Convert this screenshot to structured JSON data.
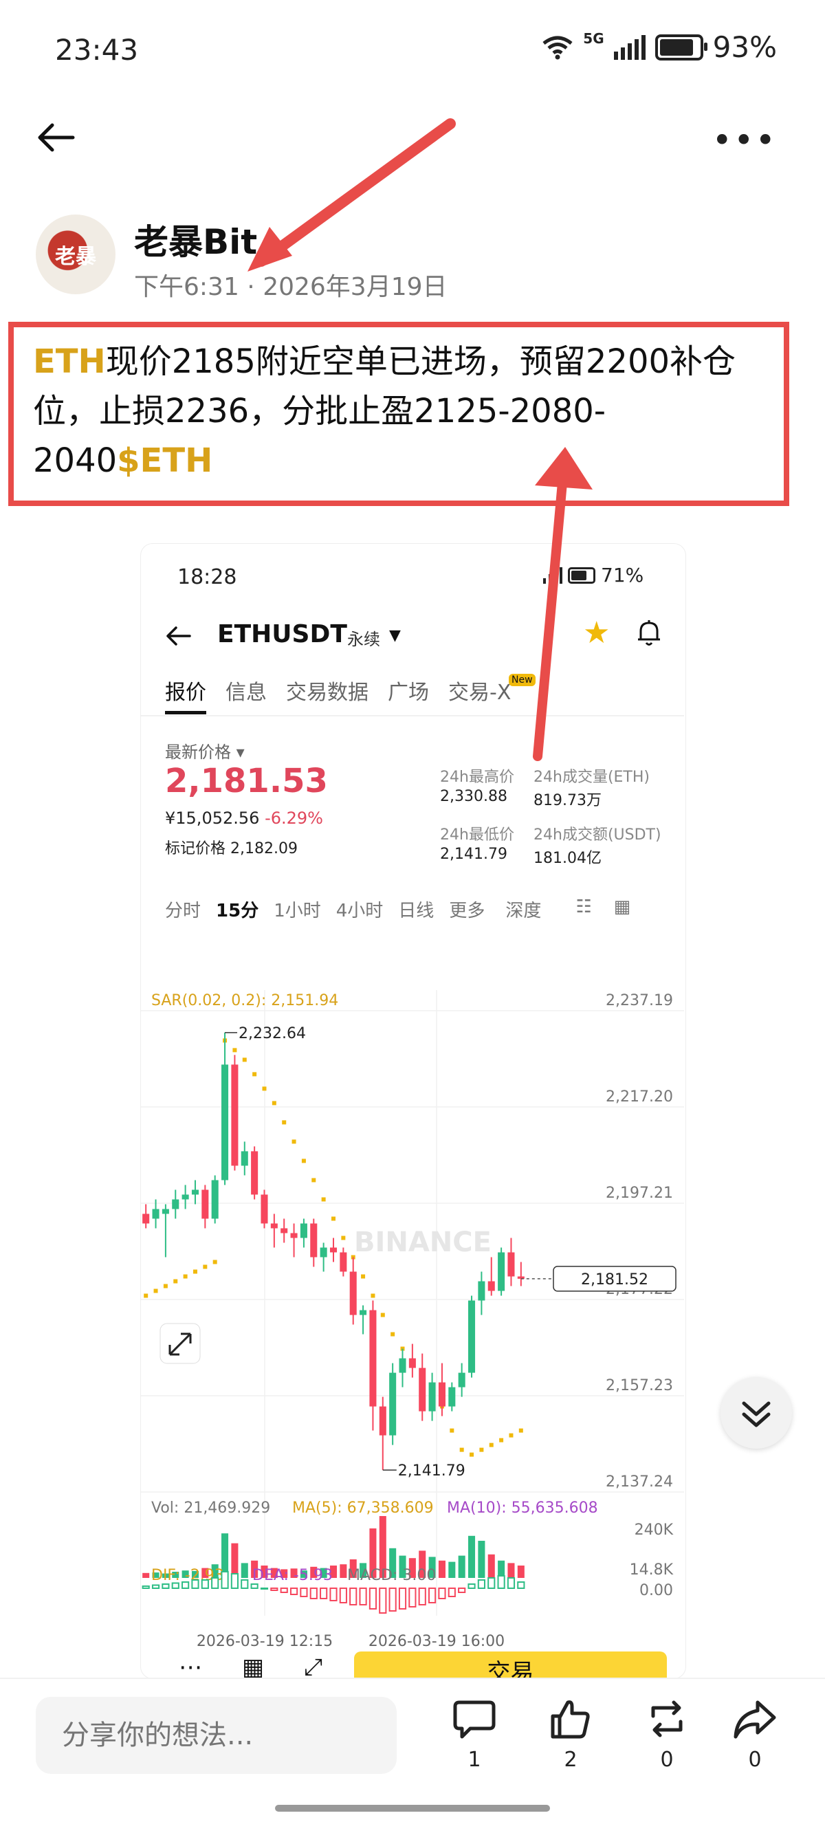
{
  "status_bar": {
    "time": "23:43",
    "network": "5G",
    "battery": "93%",
    "battery_level": 0.93
  },
  "header": {
    "back_icon": "arrow-left-icon",
    "more_label": "•••"
  },
  "author": {
    "name": "老暴Bit",
    "avatar_text": "老暴",
    "time": "下午6:31",
    "date": "2026年3月19日"
  },
  "post": {
    "ticker_1": "ETH",
    "text_1": "现价2185附近空单已进场，预留2200补仓位，止损2236，分批止盈2125-2080-2040",
    "ticker_2": "$ETH"
  },
  "screenshot": {
    "time": "18:28",
    "battery": "71%",
    "symbol": "ETHUSDT",
    "contract_type": "永续",
    "tabs": [
      "报价",
      "信息",
      "交易数据",
      "广场",
      "交易-X"
    ],
    "new_badge": "New",
    "last_price_label": "最新价格",
    "last_price": "2,181.53",
    "cny_price": "¥15,052.56",
    "change": "-6.29%",
    "mark_price_label": "标记价格",
    "mark_price": "2,182.09",
    "stats": {
      "high_label": "24h最高价",
      "high": "2,330.88",
      "low_label": "24h最低价",
      "low": "2,141.79",
      "vol_eth_label": "24h成交量(ETH)",
      "vol_eth": "819.73万",
      "vol_usdt_label": "24h成交额(USDT)",
      "vol_usdt": "181.04亿"
    },
    "intervals": [
      "分时",
      "15分",
      "1小时",
      "4小时",
      "日线",
      "更多",
      "深度"
    ],
    "active_interval": "15分",
    "sar_label": "SAR(0.02, 0.2): 2,151.94",
    "watermark": "BINANCE",
    "price_axis": [
      "2,237.19",
      "2,217.20",
      "2,197.21",
      "2,177.22",
      "2,157.23",
      "2,137.24"
    ],
    "current_price_tag": "2,181.52",
    "high_marker": "2,232.64",
    "low_marker": "2,141.79",
    "vol_label": "Vol: 21,469.929",
    "ma5_label": "MA(5): 67,358.609",
    "ma10_label": "MA(10): 55,635.608",
    "vol_axis": [
      "240K",
      "14.8K"
    ],
    "macd_dif": "DIF: -2.93",
    "macd_dea": "DEA: -5.93",
    "macd_val": "MACD: 3.00",
    "macd_axis": "0.00",
    "date_1": "2026-03-19 12:15",
    "date_2": "2026-03-19 16:00",
    "trade_button": "交易",
    "colors": {
      "up": "#2ebd85",
      "down": "#f6465d",
      "accent": "#f0b90b",
      "price": "#e0465b"
    }
  },
  "chart_data": {
    "type": "candlestick",
    "interval": "15m",
    "ylim": [
      2137.24,
      2237.19
    ],
    "candles_ohlc": [
      [
        2195,
        2197,
        2192,
        2193
      ],
      [
        2194,
        2198,
        2192,
        2196
      ],
      [
        2195,
        2197,
        2186,
        2196
      ],
      [
        2196,
        2200,
        2194,
        2198
      ],
      [
        2198,
        2201,
        2196,
        2199
      ],
      [
        2199,
        2202,
        2197,
        2200
      ],
      [
        2200,
        2201,
        2192,
        2194
      ],
      [
        2194,
        2203,
        2193,
        2202
      ],
      [
        2202,
        2232.64,
        2201,
        2226
      ],
      [
        2226,
        2228,
        2204,
        2205
      ],
      [
        2205,
        2210,
        2203,
        2208
      ],
      [
        2208,
        2209,
        2198,
        2199
      ],
      [
        2199,
        2200,
        2192,
        2193
      ],
      [
        2193,
        2195,
        2188,
        2192
      ],
      [
        2192,
        2194,
        2189,
        2191
      ],
      [
        2191,
        2193,
        2186,
        2190
      ],
      [
        2190,
        2194,
        2188,
        2193
      ],
      [
        2193,
        2194,
        2184,
        2186
      ],
      [
        2186,
        2189,
        2183,
        2188
      ],
      [
        2188,
        2190,
        2185,
        2187
      ],
      [
        2187,
        2188,
        2182,
        2183
      ],
      [
        2183,
        2186,
        2172,
        2174
      ],
      [
        2174,
        2176,
        2170,
        2175
      ],
      [
        2175,
        2177,
        2150,
        2155
      ],
      [
        2155,
        2157,
        2141.79,
        2149
      ],
      [
        2149,
        2164,
        2147,
        2162
      ],
      [
        2162,
        2167,
        2159,
        2165
      ],
      [
        2165,
        2168,
        2161,
        2163
      ],
      [
        2163,
        2166,
        2152,
        2154
      ],
      [
        2154,
        2162,
        2152,
        2160
      ],
      [
        2160,
        2164,
        2153,
        2155
      ],
      [
        2155,
        2160,
        2154,
        2159
      ],
      [
        2159,
        2164,
        2157,
        2162
      ],
      [
        2162,
        2178,
        2161,
        2177
      ],
      [
        2177,
        2183,
        2174,
        2181
      ],
      [
        2181,
        2186,
        2178,
        2179
      ],
      [
        2179,
        2188,
        2178,
        2187
      ],
      [
        2187,
        2190,
        2180,
        2182
      ],
      [
        2182,
        2185,
        2180,
        2181.52
      ]
    ],
    "sar_dots": [
      2178,
      2179,
      2180,
      2181,
      2182,
      2183,
      2184,
      2185,
      2231,
      2229,
      2227,
      2224,
      2221,
      2218,
      2214,
      2210,
      2206,
      2202,
      2198,
      2194,
      2190,
      2186,
      2182,
      2178,
      2174,
      2170,
      2167,
      2164,
      2161,
      2158,
      2155,
      2150,
      2146,
      2145,
      2146,
      2147,
      2148,
      2149,
      2150
    ],
    "volume_k": [
      20,
      22,
      18,
      25,
      30,
      28,
      40,
      55,
      180,
      140,
      60,
      70,
      50,
      40,
      35,
      38,
      30,
      45,
      40,
      50,
      55,
      75,
      60,
      200,
      250,
      120,
      90,
      80,
      110,
      85,
      70,
      65,
      90,
      170,
      150,
      95,
      70,
      60,
      50
    ],
    "macd_hist": [
      1,
      1.5,
      2,
      2.5,
      3,
      4,
      4,
      5,
      8,
      7,
      4,
      2,
      0,
      -1,
      -2,
      -3,
      -4,
      -5,
      -5,
      -6,
      -7,
      -8,
      -8,
      -10,
      -12,
      -11,
      -10,
      -9,
      -8,
      -7,
      -5,
      -4,
      -2,
      2,
      4,
      5,
      6,
      5,
      3
    ]
  },
  "actions": {
    "comment_placeholder": "分享你的想法...",
    "comments": "1",
    "likes": "2",
    "reposts": "0",
    "shares": "0"
  }
}
